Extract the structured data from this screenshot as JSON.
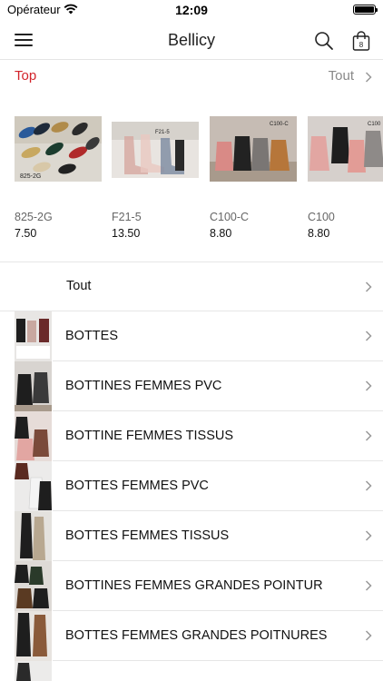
{
  "status": {
    "carrier": "Opérateur",
    "time": "12:09"
  },
  "nav": {
    "title": "Bellicy"
  },
  "top": {
    "title": "Top",
    "see_all": "Tout"
  },
  "products": [
    {
      "code": "825-2G",
      "price": "7.50",
      "tag": "825-2G"
    },
    {
      "code": "F21-5",
      "price": "13.50",
      "tag": "F21-5"
    },
    {
      "code": "C100-C",
      "price": "8.80",
      "tag": "C100-C"
    },
    {
      "code": "C100",
      "price": "8.80",
      "tag": "C100"
    }
  ],
  "categories": {
    "all_label": "Tout",
    "items": [
      {
        "label": "BOTTES"
      },
      {
        "label": "BOTTINES FEMMES PVC"
      },
      {
        "label": "BOTTINE FEMMES TISSUS"
      },
      {
        "label": "BOTTES FEMMES PVC"
      },
      {
        "label": "BOTTES FEMMES TISSUS"
      },
      {
        "label": "BOTTINES FEMMES GRANDES POINTUR"
      },
      {
        "label": "BOTTES FEMMES GRANDES POITNURES"
      }
    ]
  },
  "colors": {
    "accent": "#d2232a",
    "muted": "#888888",
    "separator": "#e6e6e6"
  }
}
